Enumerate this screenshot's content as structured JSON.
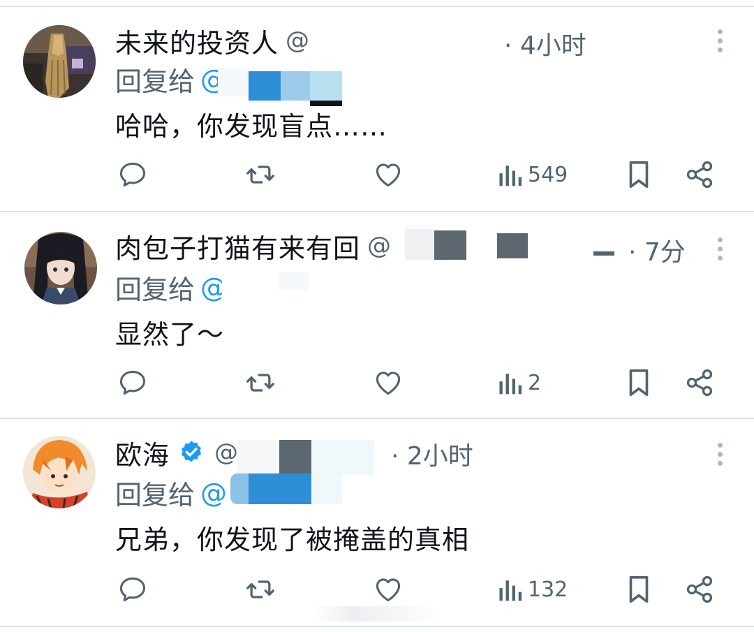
{
  "tweets": [
    {
      "name": "未来的投资人",
      "handle": "@",
      "time": "· 4小时",
      "reply_prefix": "回复给",
      "reply_handle": "@",
      "text": "哈哈，你发现盲点……",
      "views": "549",
      "verified": false
    },
    {
      "name": "肉包子打猫有来有回",
      "handle": "@",
      "time": "· 7分",
      "reply_prefix": "回复给",
      "reply_handle": "@",
      "text": "显然了～",
      "views": "2",
      "verified": false
    },
    {
      "name": "欧海",
      "handle": "@",
      "time": "· 2小时",
      "reply_prefix": "回复给",
      "reply_handle": "@",
      "text": "兄弟，你发现了被掩盖的真相",
      "views": "132",
      "verified": true
    }
  ],
  "icons": [
    "reply-icon",
    "retweet-icon",
    "like-icon",
    "views-icon",
    "bookmark-icon",
    "share-icon",
    "more-icon",
    "verified-badge-icon"
  ],
  "colors": {
    "text": "#0f1419",
    "secondary": "#536471",
    "accent": "#1d9bf0",
    "divider": "#dfe3e6"
  }
}
